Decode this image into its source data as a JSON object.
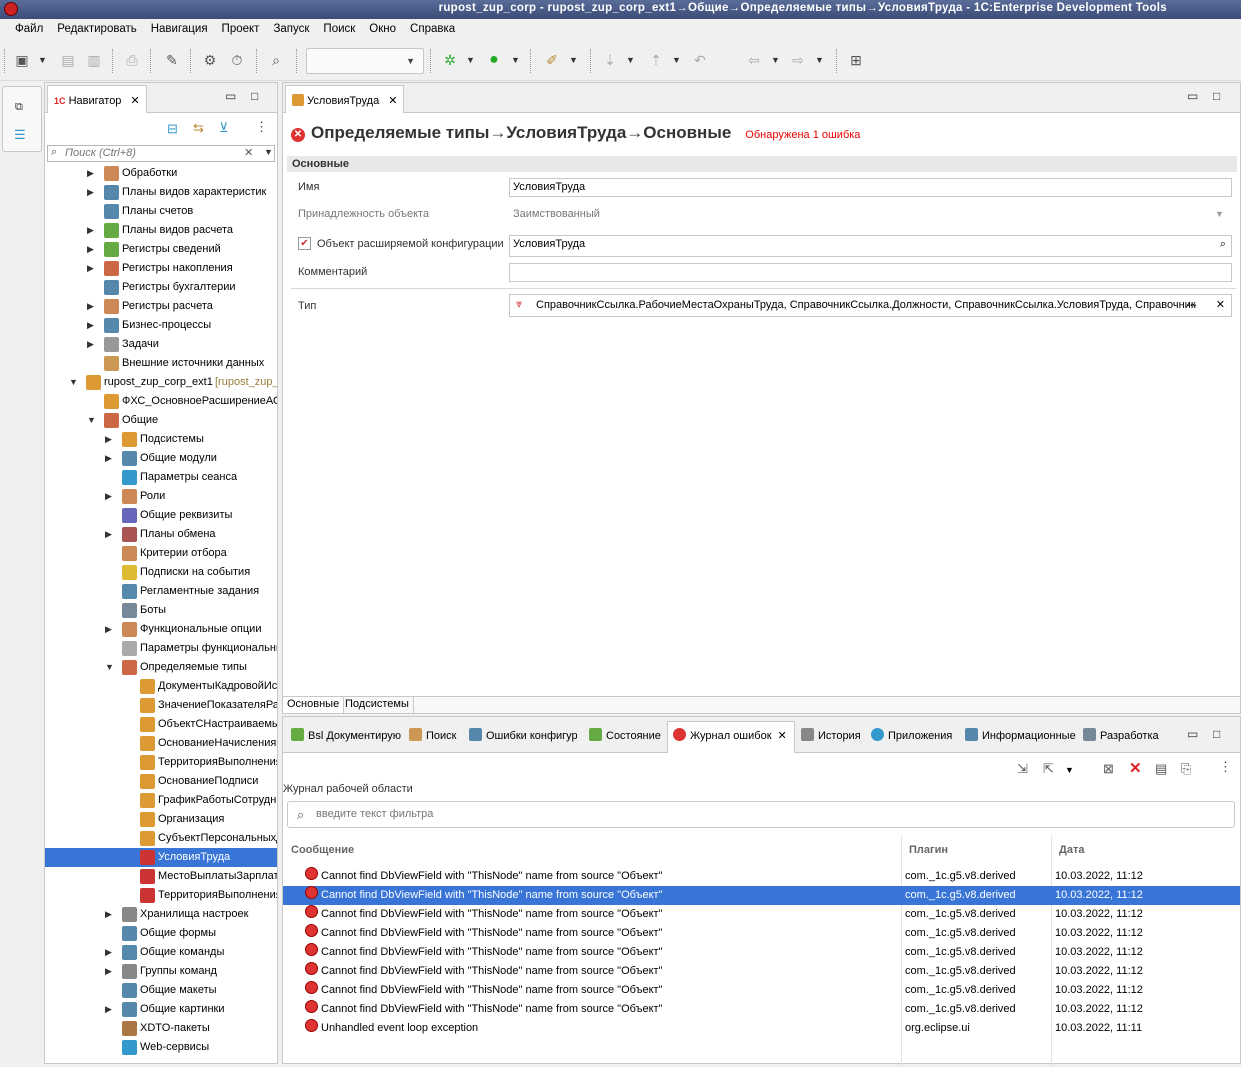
{
  "window": {
    "title": "rupost_zup_corp - rupost_zup_corp_ext1→Общие→Определяемые типы→УсловияТруда - 1C:Enterprise Development Tools"
  },
  "menu": [
    "Файл",
    "Редактировать",
    "Навигация",
    "Проект",
    "Запуск",
    "Поиск",
    "Окно",
    "Справка"
  ],
  "navigator": {
    "tab_label": "Навигатор",
    "search_placeholder": "Поиск (Ctrl+8)",
    "items": [
      {
        "label": "Обработки",
        "depth": 1,
        "arrow": "right",
        "icon": "#c85"
      },
      {
        "label": "Планы видов характеристик",
        "depth": 1,
        "arrow": "right",
        "icon": "#58a"
      },
      {
        "label": "Планы счетов",
        "depth": 1,
        "arrow": "",
        "icon": "#58a"
      },
      {
        "label": "Планы видов расчета",
        "depth": 1,
        "arrow": "right",
        "icon": "#6a4"
      },
      {
        "label": "Регистры сведений",
        "depth": 1,
        "arrow": "right",
        "icon": "#6a4"
      },
      {
        "label": "Регистры накопления",
        "depth": 1,
        "arrow": "right",
        "icon": "#c64"
      },
      {
        "label": "Регистры бухгалтерии",
        "depth": 1,
        "arrow": "",
        "icon": "#58a"
      },
      {
        "label": "Регистры расчета",
        "depth": 1,
        "arrow": "right",
        "icon": "#c85"
      },
      {
        "label": "Бизнес-процессы",
        "depth": 1,
        "arrow": "right",
        "icon": "#58a"
      },
      {
        "label": "Задачи",
        "depth": 1,
        "arrow": "right",
        "icon": "#999"
      },
      {
        "label": "Внешние источники данных",
        "depth": 1,
        "arrow": "",
        "icon": "#c95"
      },
      {
        "label": "rupost_zup_corp_ext1",
        "hint": "[rupost_zup_corp",
        "depth": 0,
        "arrow": "down",
        "icon": "#d93"
      },
      {
        "label": "ФХС_ОсновноеРасширениеАСЗУП",
        "depth": 1,
        "arrow": "",
        "icon": "#d93"
      },
      {
        "label": "Общие",
        "depth": 1,
        "arrow": "down",
        "icon": "#c64"
      },
      {
        "label": "Подсистемы",
        "depth": 2,
        "arrow": "right",
        "icon": "#d93"
      },
      {
        "label": "Общие модули",
        "depth": 2,
        "arrow": "right",
        "icon": "#58a"
      },
      {
        "label": "Параметры сеанса",
        "depth": 2,
        "arrow": "",
        "icon": "#39c"
      },
      {
        "label": "Роли",
        "depth": 2,
        "arrow": "right",
        "icon": "#c85"
      },
      {
        "label": "Общие реквизиты",
        "depth": 2,
        "arrow": "",
        "icon": "#66b"
      },
      {
        "label": "Планы обмена",
        "depth": 2,
        "arrow": "right",
        "icon": "#a55"
      },
      {
        "label": "Критерии отбора",
        "depth": 2,
        "arrow": "",
        "icon": "#c85"
      },
      {
        "label": "Подписки на события",
        "depth": 2,
        "arrow": "",
        "icon": "#db3"
      },
      {
        "label": "Регламентные задания",
        "depth": 2,
        "arrow": "",
        "icon": "#58a"
      },
      {
        "label": "Боты",
        "depth": 2,
        "arrow": "",
        "icon": "#789"
      },
      {
        "label": "Функциональные опции",
        "depth": 2,
        "arrow": "right",
        "icon": "#c85"
      },
      {
        "label": "Параметры функциональных опций",
        "depth": 2,
        "arrow": "",
        "icon": "#aaa"
      },
      {
        "label": "Определяемые типы",
        "depth": 2,
        "arrow": "down",
        "icon": "#c64"
      },
      {
        "label": "ДокументыКадровойИсторииСотрудников",
        "depth": 3,
        "arrow": "",
        "icon": "#d93"
      },
      {
        "label": "ЗначениеПоказателяРасчетаЗарплаты",
        "depth": 3,
        "arrow": "",
        "icon": "#d93"
      },
      {
        "label": "ОбъектСНастраиваемымПредставлением",
        "depth": 3,
        "arrow": "",
        "icon": "#d93"
      },
      {
        "label": "ОснованиеНачисления",
        "depth": 3,
        "arrow": "",
        "icon": "#d93"
      },
      {
        "label": "ТерриторияВыполненияРабот",
        "depth": 3,
        "arrow": "",
        "icon": "#d93"
      },
      {
        "label": "ОснованиеПодписи",
        "depth": 3,
        "arrow": "",
        "icon": "#d93"
      },
      {
        "label": "ГрафикРаботыСотрудников",
        "depth": 3,
        "arrow": "",
        "icon": "#d93"
      },
      {
        "label": "Организация",
        "depth": 3,
        "arrow": "",
        "icon": "#d93"
      },
      {
        "label": "СубъектПерсональныхДанных",
        "depth": 3,
        "arrow": "",
        "icon": "#d93"
      },
      {
        "label": "УсловияТруда",
        "depth": 3,
        "arrow": "",
        "icon": "#c33",
        "selected": true
      },
      {
        "label": "МестоВыплатыЗарплатыСотрудника",
        "depth": 3,
        "arrow": "",
        "icon": "#c33"
      },
      {
        "label": "ТерриторияВыполненияРаботВОрганизации",
        "depth": 3,
        "arrow": "",
        "icon": "#c33"
      },
      {
        "label": "Хранилища настроек",
        "depth": 2,
        "arrow": "right",
        "icon": "#888"
      },
      {
        "label": "Общие формы",
        "depth": 2,
        "arrow": "",
        "icon": "#58a"
      },
      {
        "label": "Общие команды",
        "depth": 2,
        "arrow": "right",
        "icon": "#58a"
      },
      {
        "label": "Группы команд",
        "depth": 2,
        "arrow": "right",
        "icon": "#888"
      },
      {
        "label": "Общие макеты",
        "depth": 2,
        "arrow": "",
        "icon": "#58a"
      },
      {
        "label": "Общие картинки",
        "depth": 2,
        "arrow": "right",
        "icon": "#58a"
      },
      {
        "label": "XDTO-пакеты",
        "depth": 2,
        "arrow": "",
        "icon": "#a74"
      },
      {
        "label": "Web-сервисы",
        "depth": 2,
        "arrow": "",
        "icon": "#39c"
      }
    ]
  },
  "editor": {
    "tab_label": "УсловияТруда",
    "title": "Определяемые типы→УсловияТруда→Основные",
    "error_text": "Обнаружена 1 ошибка",
    "section": "Основные",
    "fields": {
      "name_label": "Имя",
      "name_value": "УсловияТруда",
      "belong_label": "Принадлежность объекта",
      "belong_value": "Заимствованный",
      "ext_label": "Объект расширяемой конфигурации",
      "ext_value": "УсловияТруда",
      "comment_label": "Комментарий",
      "comment_value": "",
      "type_label": "Тип",
      "type_value": "СправочникСсылка.РабочиеМестаОхраныТруда, СправочникСсылка.Должности, СправочникСсылка.УсловияТруда, Справочник"
    },
    "bottom_tabs": [
      "Основные",
      "Подсистемы"
    ]
  },
  "bottom_panel": {
    "tabs": [
      "Bsl Документирую",
      "Поиск",
      "Ошибки конфигур",
      "Состояние",
      "Журнал ошибок",
      "История",
      "Приложения",
      "Информационные",
      "Разработка"
    ],
    "log_label": "Журнал рабочей области",
    "filter_placeholder": "введите текст фильтра",
    "columns": [
      "Сообщение",
      "Плагин",
      "Дата"
    ],
    "rows": [
      {
        "message": "Cannot find DbViewField with \"ThisNode\" name from source \"Объект\"",
        "plugin": "com._1c.g5.v8.derived",
        "date": "10.03.2022, 11:12"
      },
      {
        "message": "Cannot find DbViewField with \"ThisNode\" name from source \"Объект\"",
        "plugin": "com._1c.g5.v8.derived",
        "date": "10.03.2022, 11:12",
        "selected": true
      },
      {
        "message": "Cannot find DbViewField with \"ThisNode\" name from source \"Объект\"",
        "plugin": "com._1c.g5.v8.derived",
        "date": "10.03.2022, 11:12"
      },
      {
        "message": "Cannot find DbViewField with \"ThisNode\" name from source \"Объект\"",
        "plugin": "com._1c.g5.v8.derived",
        "date": "10.03.2022, 11:12"
      },
      {
        "message": "Cannot find DbViewField with \"ThisNode\" name from source \"Объект\"",
        "plugin": "com._1c.g5.v8.derived",
        "date": "10.03.2022, 11:12"
      },
      {
        "message": "Cannot find DbViewField with \"ThisNode\" name from source \"Объект\"",
        "plugin": "com._1c.g5.v8.derived",
        "date": "10.03.2022, 11:12"
      },
      {
        "message": "Cannot find DbViewField with \"ThisNode\" name from source \"Объект\"",
        "plugin": "com._1c.g5.v8.derived",
        "date": "10.03.2022, 11:12"
      },
      {
        "message": "Cannot find DbViewField with \"ThisNode\" name from source \"Объект\"",
        "plugin": "com._1c.g5.v8.derived",
        "date": "10.03.2022, 11:12"
      },
      {
        "message": "Unhandled event loop exception",
        "plugin": "org.eclipse.ui",
        "date": "10.03.2022, 11:11"
      }
    ]
  },
  "colors": {
    "selection": "#3875d7",
    "error": "#e00000"
  }
}
